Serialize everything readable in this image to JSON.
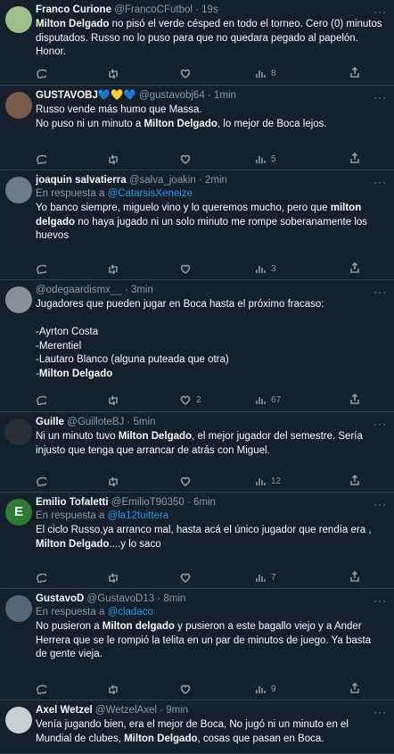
{
  "tweets": [
    {
      "name": "Franco Curione",
      "handle": "@FrancoCFutbol",
      "time": "19s",
      "reply_to": "",
      "lines": [
        {
          "pre": "",
          "bold": "Milton Delgado",
          "post": " no pisó el verde césped en todo el torneo. Cero (0) minutos"
        },
        {
          "pre": "disputados. Russo no lo puso para que no quedara pegado al papelón.",
          "bold": "",
          "post": ""
        },
        {
          "pre": "Honor.",
          "bold": "",
          "post": ""
        }
      ],
      "replies": "",
      "retweets": "",
      "likes": "",
      "views": "8",
      "avatar_color": "#9bbf8a"
    },
    {
      "name": "GUSTAVOBJ💙💛💙",
      "handle": "@gustavobj64",
      "time": "1min",
      "reply_to": "",
      "lines": [
        {
          "pre": "Russo vende más humo que Massa.",
          "bold": "",
          "post": ""
        },
        {
          "pre": "No puso ni un minuto a ",
          "bold": "Milton Delgado",
          "post": ", lo mejor de Boca lejos."
        }
      ],
      "replies": "",
      "retweets": "",
      "likes": "",
      "views": "5",
      "avatar_color": "#7a5a4a"
    },
    {
      "name": "joaquin salvatierra",
      "handle": "@salva_joakin",
      "time": "2min",
      "reply_to": "@CatarsisXeneize",
      "reply_prefix": "En respuesta a ",
      "lines": [
        {
          "pre": "Yo banco siempre, miguelo vino y lo queremos mucho, pero que ",
          "bold": "milton",
          "post": ""
        },
        {
          "pre": "",
          "bold": "delgado",
          "post": " no haya jugado ni un solo minuto me rompe soberanamente los"
        },
        {
          "pre": "huevos",
          "bold": "",
          "post": ""
        }
      ],
      "replies": "",
      "retweets": "",
      "likes": "",
      "views": "3",
      "avatar_color": "#6e7a86"
    },
    {
      "name": "",
      "handle": "@odegaardismx__",
      "time": "3min",
      "reply_to": "",
      "lines": [
        {
          "pre": "Jugadores que pueden jugar en Boca hasta el próximo fracaso:",
          "bold": "",
          "post": ""
        },
        {
          "pre": " ",
          "bold": "",
          "post": ""
        },
        {
          "pre": "-Ayrton Costa",
          "bold": "",
          "post": ""
        },
        {
          "pre": "-Merentiel",
          "bold": "",
          "post": ""
        },
        {
          "pre": "-Lautaro Blanco (alguna puteada que otra)",
          "bold": "",
          "post": ""
        },
        {
          "pre": "-",
          "bold": "Milton Delgado",
          "post": ""
        }
      ],
      "replies": "",
      "retweets": "",
      "likes": "2",
      "views": "67",
      "avatar_color": "#8a8f95"
    },
    {
      "name": "Guille",
      "handle": "@GuilloteBJ",
      "time": "5min",
      "reply_to": "",
      "lines": [
        {
          "pre": "Ni un minuto tuvo ",
          "bold": "Milton Delgado",
          "post": ", el mejor jugador del semestre. Sería"
        },
        {
          "pre": "injusto que tenga que arrancar de atrás con Miguel.",
          "bold": "",
          "post": ""
        }
      ],
      "replies": "",
      "retweets": "",
      "likes": "",
      "views": "12",
      "avatar_color": "#2a2f35"
    },
    {
      "name": "Emilio Tofaletti",
      "handle": "@EmilioT90350",
      "time": "6min",
      "reply_to": "@la12tuittera",
      "reply_prefix": "En respuesta a ",
      "avatar_letter": "E",
      "lines": [
        {
          "pre": "El ciclo Russo,ya arranco mal, hasta acá el único jugador que rendía era ,",
          "bold": "",
          "post": ""
        },
        {
          "pre": "",
          "bold": "Milton Delgado",
          "post": "....y lo saco"
        }
      ],
      "replies": "",
      "retweets": "",
      "likes": "",
      "views": "7",
      "avatar_color": "#2e7d32"
    },
    {
      "name": "GustavoD",
      "handle": "@GustavoD13",
      "time": "8min",
      "reply_to": "@cladaco",
      "reply_prefix": "En respuesta a ",
      "lines": [
        {
          "pre": "No pusieron a ",
          "bold": "Milton delgado",
          "post": " y pusieron a este bagallo viejo y a Ander"
        },
        {
          "pre": "Herrera que se le rompió la telita en un par de minutos de juego. Ya basta",
          "bold": "",
          "post": ""
        },
        {
          "pre": "de gente vieja.",
          "bold": "",
          "post": ""
        }
      ],
      "replies": "",
      "retweets": "",
      "likes": "",
      "views": "9",
      "avatar_color": "#556677"
    },
    {
      "name": "Axel Wetzel",
      "handle": "@WetzelAxel",
      "time": "9min",
      "reply_to": "",
      "lines": [
        {
          "pre": "Venía jugando bien, era el mejor de Boca, No jugó ni un minuto en el",
          "bold": "",
          "post": ""
        },
        {
          "pre": "Mundial de clubes, ",
          "bold": "Milton Delgado",
          "post": ", cosas que pasan en Boca."
        }
      ],
      "replies": "",
      "retweets": "",
      "likes": "",
      "views": "",
      "avatar_color": "#c9ced3"
    }
  ]
}
